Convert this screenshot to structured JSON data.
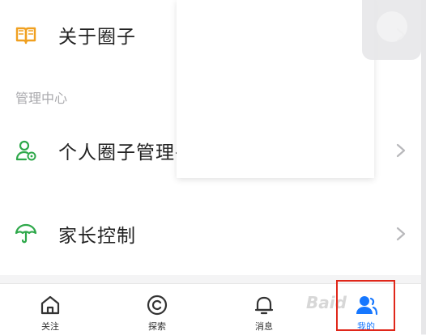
{
  "menu": {
    "about": {
      "label": "关于圈子",
      "icon": "book-icon"
    },
    "section_title": "管理中心",
    "manage": {
      "label": "个人圈子管理平台",
      "icon": "person-gear-icon"
    },
    "parental": {
      "label": "家长控制",
      "icon": "umbrella-icon"
    }
  },
  "tabbar": {
    "tabs": [
      {
        "label": "关注",
        "icon": "home-icon"
      },
      {
        "label": "探索",
        "icon": "explore-icon"
      },
      {
        "label": "消息",
        "icon": "bell-icon"
      },
      {
        "label": "我的",
        "icon": "profile-icon",
        "active": true
      }
    ]
  },
  "watermark": "Baid",
  "colors": {
    "accent": "#1677ff",
    "green": "#2ea84a",
    "orange": "#f0a020",
    "highlight": "#e0271a"
  }
}
